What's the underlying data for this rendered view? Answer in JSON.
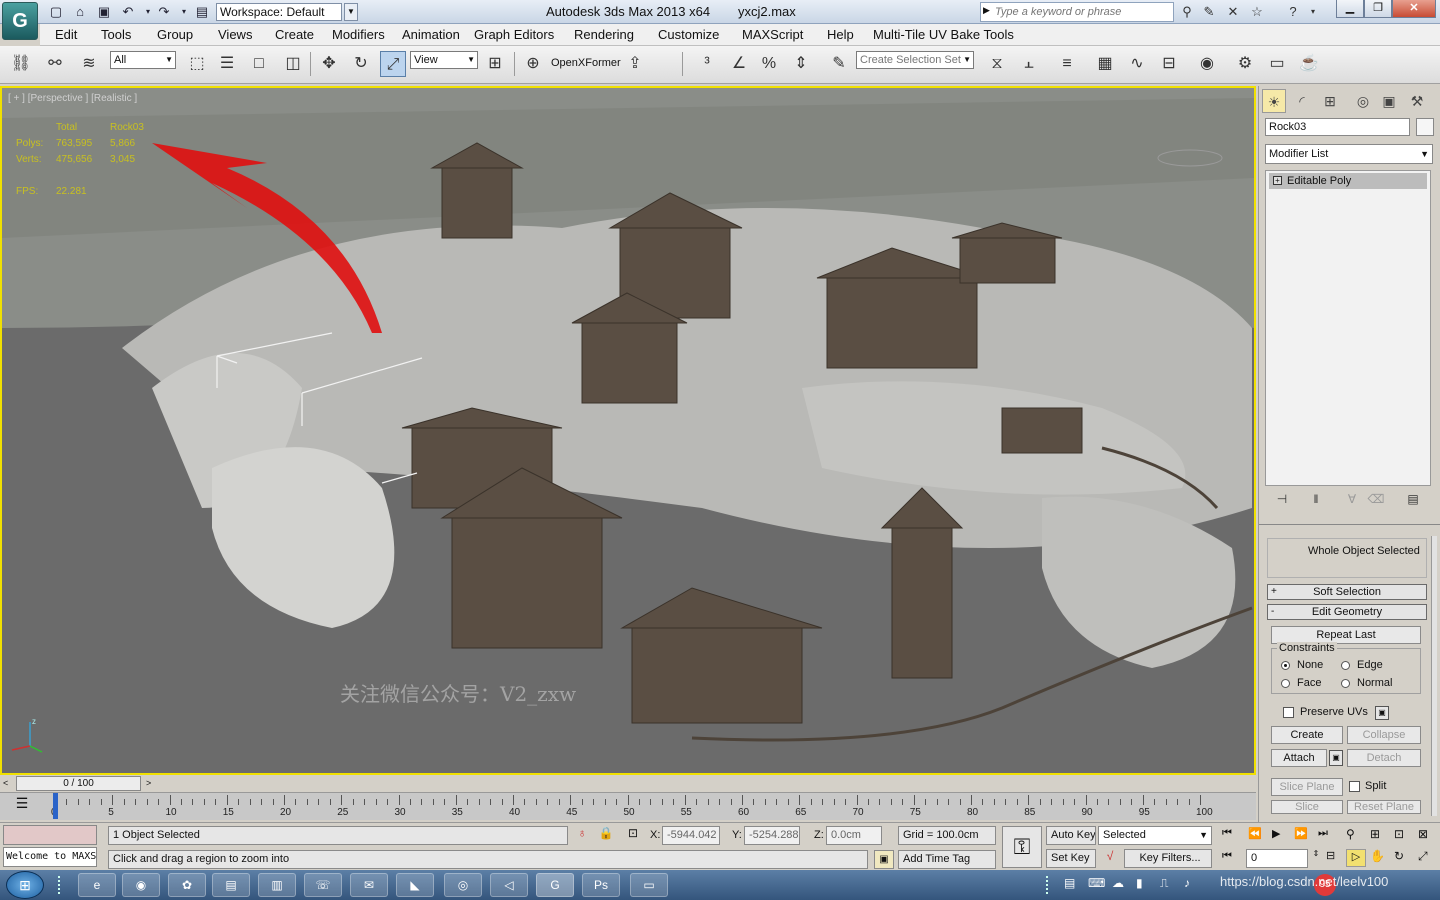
{
  "titlebar": {
    "workspace": "Workspace: Default",
    "app_title": "Autodesk 3ds Max  2013 x64",
    "file_name": "yxcj2.max",
    "search_placeholder": "Type a keyword or phrase"
  },
  "menu": [
    "Edit",
    "Tools",
    "Group",
    "Views",
    "Create",
    "Modifiers",
    "Animation",
    "Graph Editors",
    "Rendering",
    "Customize",
    "MAXScript",
    "Help",
    "Multi-Tile UV Bake Tools"
  ],
  "toolbar": {
    "selection_filter": "All",
    "ref_coord": "View",
    "openx_label": "OpenXFormer",
    "named_selection": "Create Selection Set"
  },
  "viewport": {
    "label": "[ + ] [Perspective ] [Realistic ]",
    "stats": {
      "col_total": "Total",
      "col_object": "Rock03",
      "polys_label": "Polys:",
      "polys_total": "763,595",
      "polys_object": "5,866",
      "verts_label": "Verts:",
      "verts_total": "475,656",
      "verts_object": "3,045",
      "fps_label": "FPS:",
      "fps_value": "22.281"
    },
    "watermark": "关注微信公众号：V2_zxw"
  },
  "command_panel": {
    "object_name": "Rock03",
    "modifier_list": "Modifier List",
    "stack_item": "Editable Poly",
    "selection_status": "Whole Object Selected",
    "soft_selection": "Soft Selection",
    "edit_geometry": "Edit Geometry",
    "repeat_last": "Repeat Last",
    "constraints_label": "Constraints",
    "c_none": "None",
    "c_edge": "Edge",
    "c_face": "Face",
    "c_normal": "Normal",
    "preserve_uvs": "Preserve UVs",
    "create": "Create",
    "collapse": "Collapse",
    "attach": "Attach",
    "detach": "Detach",
    "slice_plane": "Slice Plane",
    "split": "Split",
    "slice": "Slice",
    "reset_plane": "Reset Plane"
  },
  "timeline": {
    "frame_counter": "0 / 100",
    "ticks": [
      "0",
      "5",
      "10",
      "15",
      "20",
      "25",
      "30",
      "35",
      "40",
      "45",
      "50",
      "55",
      "60",
      "65",
      "70",
      "75",
      "80",
      "85",
      "90",
      "95",
      "100"
    ]
  },
  "status": {
    "selected": "1 Object Selected",
    "prompt": "Click and drag a region to zoom into",
    "maxscript": "Welcome to MAXS",
    "x_label": "X:",
    "x_value": "-5944.042",
    "y_label": "Y:",
    "y_value": "-5254.288",
    "z_label": "Z:",
    "z_value": "0.0cm",
    "grid": "Grid = 100.0cm",
    "add_time_tag": "Add Time Tag",
    "auto_key": "Auto Key",
    "key_mode": "Selected",
    "set_key": "Set Key",
    "key_filters": "Key Filters...",
    "current_frame": "0"
  },
  "taskbar": {
    "watermark_url": "https://blog.csdn.net/leelv100",
    "badge": "95"
  },
  "colors": {
    "viewport_border": "#f0e000",
    "stats_text": "#c8c020",
    "arrow": "#e01010"
  }
}
